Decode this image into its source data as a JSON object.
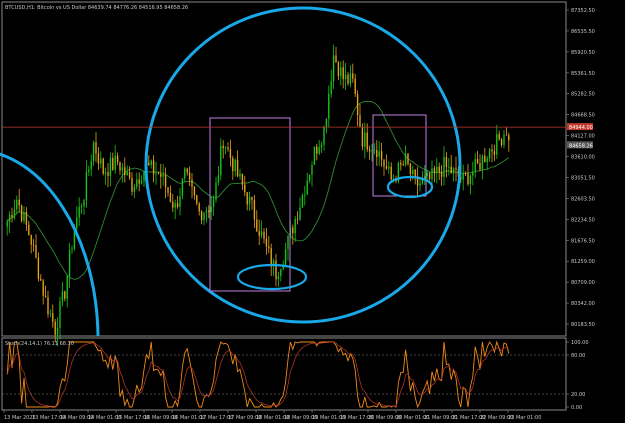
{
  "symbol_info": "BTCUSD,H1:  Bitcoin vs US Dollar  84639.74 84776.26 84516.95 84658.26",
  "osc_info": "Stoch(24,14,1) 76.11 68.30",
  "colors": {
    "background": "#000000",
    "frame": "#8a8a8a",
    "grid": "#2a2a2a",
    "candle_up": "#18c418",
    "candle_down": "#e6a21a",
    "moving_average": "#2f8a2f",
    "hline": "#c0392b",
    "annotation_circle": "#19a8e8",
    "annotation_box": "#c080e0",
    "stoch_main": "#f08a18",
    "stoch_signal": "#c0392b"
  },
  "current_price_label": "84658.26",
  "price_level_label": "84944.00",
  "chart_data": {
    "type": "candlestick",
    "title": "BTCUSD,H1",
    "ylim": [
      80480,
      87600
    ],
    "y_ticks": [
      "87352.50",
      "86535.50",
      "85920.50",
      "85361.50",
      "85282.50",
      "84668.50",
      "84127.00",
      "83610.00",
      "83051.50",
      "82603.50",
      "82234.50",
      "81676.50",
      "81259.00",
      "80709.00",
      "80342.00",
      "80183.50"
    ],
    "x_ticks": [
      "13 Mar 2025",
      "13 Mar 17:00",
      "14 Mar 09:00",
      "14 Mar 01:00",
      "15 Mar 17:00",
      "16 Mar 09:00",
      "16 Mar 01:00",
      "17 Mar 17:00",
      "17 Mar 09:00",
      "18 Mar 01:00",
      "18 Mar 09:00",
      "19 Mar 01:00",
      "19 Mar 17:00",
      "20 Mar 09:00",
      "20 Mar 01:00",
      "21 Mar 09:00",
      "21 Mar 17:00",
      "22 Mar 09:00",
      "23 Mar 01:00"
    ],
    "anchors": [
      [
        0,
        82900
      ],
      [
        4,
        83400
      ],
      [
        10,
        82500
      ],
      [
        16,
        81200
      ],
      [
        20,
        80600
      ],
      [
        24,
        81400
      ],
      [
        28,
        82800
      ],
      [
        32,
        83500
      ],
      [
        36,
        84600
      ],
      [
        40,
        84000
      ],
      [
        46,
        84200
      ],
      [
        52,
        83700
      ],
      [
        58,
        84100
      ],
      [
        64,
        83900
      ],
      [
        70,
        83200
      ],
      [
        74,
        83900
      ],
      [
        80,
        83100
      ],
      [
        86,
        83300
      ],
      [
        90,
        84700
      ],
      [
        96,
        83900
      ],
      [
        102,
        83200
      ],
      [
        108,
        82300
      ],
      [
        112,
        81800
      ],
      [
        116,
        82300
      ],
      [
        122,
        83300
      ],
      [
        128,
        84400
      ],
      [
        132,
        84900
      ],
      [
        136,
        86500
      ],
      [
        140,
        86000
      ],
      [
        144,
        85900
      ],
      [
        148,
        84700
      ],
      [
        154,
        84500
      ],
      [
        160,
        83800
      ],
      [
        166,
        84200
      ],
      [
        170,
        83700
      ],
      [
        176,
        83800
      ],
      [
        182,
        84100
      ],
      [
        190,
        83800
      ],
      [
        196,
        84100
      ],
      [
        200,
        84400
      ],
      [
        204,
        84600
      ],
      [
        208,
        84900
      ],
      [
        209,
        84658
      ]
    ],
    "series_labels": [
      "Stoch(24,14,1)"
    ],
    "oscillator": {
      "name": "Stoch(24,14,1)",
      "ylim": [
        0,
        100
      ],
      "y_ticks": [
        "100.00",
        "80.00",
        "20.00",
        "0.00"
      ],
      "main_last": 76.11,
      "signal_last": 68.3
    }
  }
}
